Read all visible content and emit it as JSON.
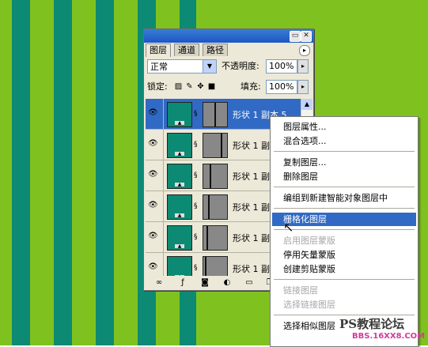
{
  "panel": {
    "tabs": [
      "图层",
      "通道",
      "路径"
    ],
    "blend_mode": "正常",
    "opacity_label": "不透明度:",
    "opacity_value": "100%",
    "lock_label": "锁定:",
    "fill_label": "填充:",
    "fill_value": "100%",
    "layers": [
      {
        "name": "形状 1 副本 5",
        "selected": true
      },
      {
        "name": "形状 1 副本",
        "selected": false
      },
      {
        "name": "形状 1 副本",
        "selected": false
      },
      {
        "name": "形状 1 副本",
        "selected": false
      },
      {
        "name": "形状 1 副本",
        "selected": false
      },
      {
        "name": "形状 1 副本",
        "selected": false
      }
    ]
  },
  "context_menu": {
    "items": [
      {
        "label": "图层属性...",
        "state": "normal"
      },
      {
        "label": "混合选项...",
        "state": "normal"
      },
      {
        "label": "复制图层...",
        "state": "normal"
      },
      {
        "label": "删除图层",
        "state": "normal"
      },
      {
        "label": "编组到新建智能对象图层中",
        "state": "normal"
      },
      {
        "label": "栅格化图层",
        "state": "highlighted"
      },
      {
        "label": "启用图层蒙版",
        "state": "disabled"
      },
      {
        "label": "停用矢量蒙版",
        "state": "normal"
      },
      {
        "label": "创建剪贴蒙版",
        "state": "normal"
      },
      {
        "label": "链接图层",
        "state": "disabled"
      },
      {
        "label": "选择链接图层",
        "state": "disabled"
      },
      {
        "label": "选择相似图层",
        "state": "normal"
      }
    ]
  },
  "watermark": {
    "title": "PS教程论坛",
    "url": "BBS.16XX8.COM"
  },
  "colors": {
    "stripe_green": "#7fc21f",
    "stripe_teal": "#0d8a73",
    "selection_blue": "#316ac5"
  }
}
